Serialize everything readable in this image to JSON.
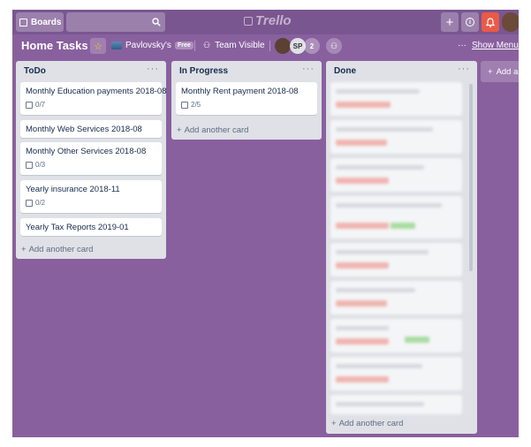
{
  "nav": {
    "boards_label": "Boards",
    "logo_text": "Trello",
    "plus": "+",
    "info": "i",
    "bell": "🔔"
  },
  "board": {
    "title": "Home Tasks",
    "team_name": "Pavlovsky's",
    "team_badge": "Free",
    "visibility": "Team Visible",
    "members": [
      {
        "initials": ""
      },
      {
        "initials": "SP"
      },
      {
        "initials": "2"
      }
    ],
    "menu_dots": "···",
    "menu_label": "Show Menu"
  },
  "lists": [
    {
      "name": "ToDo",
      "more": "···",
      "cards": [
        {
          "title": "Monthly Education payments 2018-08",
          "checklist": "0/7"
        },
        {
          "title": "Monthly Web Services 2018-08",
          "checklist": ""
        },
        {
          "title": "Monthly Other Services 2018-08",
          "checklist": "0/3"
        },
        {
          "title": "Yearly insurance 2018-11",
          "checklist": "0/2"
        },
        {
          "title": "Yearly Tax Reports 2019-01",
          "checklist": ""
        }
      ],
      "add_card": "Add another card"
    },
    {
      "name": "In Progress",
      "more": "···",
      "cards": [
        {
          "title": "Monthly Rent payment 2018-08",
          "checklist": "2/5"
        }
      ],
      "add_card": "Add another card"
    },
    {
      "name": "Done",
      "more": "···",
      "add_card": "Add another card"
    }
  ],
  "add_list": "Add a"
}
